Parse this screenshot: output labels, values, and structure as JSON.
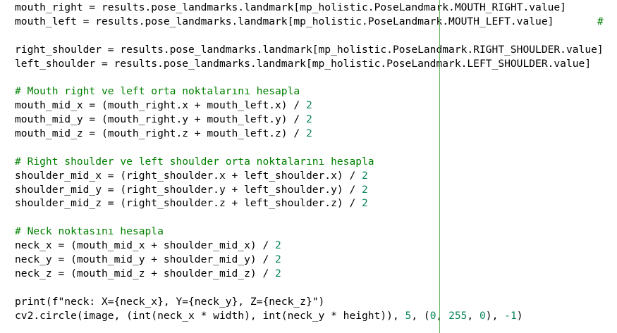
{
  "editor": {
    "colors": {
      "text": "#000000",
      "comment": "#008000",
      "number": "#098658",
      "ruler": "#5bb55b",
      "background": "#ffffff"
    },
    "lines": [
      [
        {
          "t": "mouth_right = results.pose_landmarks.landmark[mp_holistic.PoseLandmark.MOUTH_RIGHT.value]",
          "k": "p"
        }
      ],
      [
        {
          "t": "mouth_left = results.pose_landmarks.landmark[mp_holistic.PoseLandmark.MOUTH_LEFT.value]       ",
          "k": "p"
        },
        {
          "t": "#",
          "k": "c"
        }
      ],
      [],
      [
        {
          "t": "right_shoulder = results.pose_landmarks.landmark[mp_holistic.PoseLandmark.RIGHT_SHOULDER.value]",
          "k": "p"
        }
      ],
      [
        {
          "t": "left_shoulder = results.pose_landmarks.landmark[mp_holistic.PoseLandmark.LEFT_SHOULDER.value]",
          "k": "p"
        }
      ],
      [],
      [
        {
          "t": "# Mouth right ve left orta noktalarını hesapla",
          "k": "c"
        }
      ],
      [
        {
          "t": "mouth_mid_x = (mouth_right.x + mouth_left.x) / ",
          "k": "p"
        },
        {
          "t": "2",
          "k": "n"
        }
      ],
      [
        {
          "t": "mouth_mid_y = (mouth_right.y + mouth_left.y) / ",
          "k": "p"
        },
        {
          "t": "2",
          "k": "n"
        }
      ],
      [
        {
          "t": "mouth_mid_z = (mouth_right.z + mouth_left.z) / ",
          "k": "p"
        },
        {
          "t": "2",
          "k": "n"
        }
      ],
      [],
      [
        {
          "t": "# Right shoulder ve left shoulder orta noktalarını hesapla",
          "k": "c"
        }
      ],
      [
        {
          "t": "shoulder_mid_x = (right_shoulder.x + left_shoulder.x) / ",
          "k": "p"
        },
        {
          "t": "2",
          "k": "n"
        }
      ],
      [
        {
          "t": "shoulder_mid_y = (right_shoulder.y + left_shoulder.y) / ",
          "k": "p"
        },
        {
          "t": "2",
          "k": "n"
        }
      ],
      [
        {
          "t": "shoulder_mid_z = (right_shoulder.z + left_shoulder.z) / ",
          "k": "p"
        },
        {
          "t": "2",
          "k": "n"
        }
      ],
      [],
      [
        {
          "t": "# Neck noktasını hesapla",
          "k": "c"
        }
      ],
      [
        {
          "t": "neck_x = (mouth_mid_x + shoulder_mid_x) / ",
          "k": "p"
        },
        {
          "t": "2",
          "k": "n"
        }
      ],
      [
        {
          "t": "neck_y = (mouth_mid_y + shoulder_mid_y) / ",
          "k": "p"
        },
        {
          "t": "2",
          "k": "n"
        }
      ],
      [
        {
          "t": "neck_z = (mouth_mid_z + shoulder_mid_z) / ",
          "k": "p"
        },
        {
          "t": "2",
          "k": "n"
        }
      ],
      [],
      [
        {
          "t": "print(f\"neck: X={neck_x}, Y={neck_y}, Z={neck_z}\")",
          "k": "p"
        }
      ],
      [
        {
          "t": "cv2.circle(image, (int(neck_x * width), int(neck_y * height)), ",
          "k": "p"
        },
        {
          "t": "5",
          "k": "n"
        },
        {
          "t": ", (",
          "k": "p"
        },
        {
          "t": "0",
          "k": "n"
        },
        {
          "t": ", ",
          "k": "p"
        },
        {
          "t": "255",
          "k": "n"
        },
        {
          "t": ", ",
          "k": "p"
        },
        {
          "t": "0",
          "k": "n"
        },
        {
          "t": "), ",
          "k": "p"
        },
        {
          "t": "-1",
          "k": "n"
        },
        {
          "t": ")",
          "k": "p"
        }
      ]
    ]
  }
}
